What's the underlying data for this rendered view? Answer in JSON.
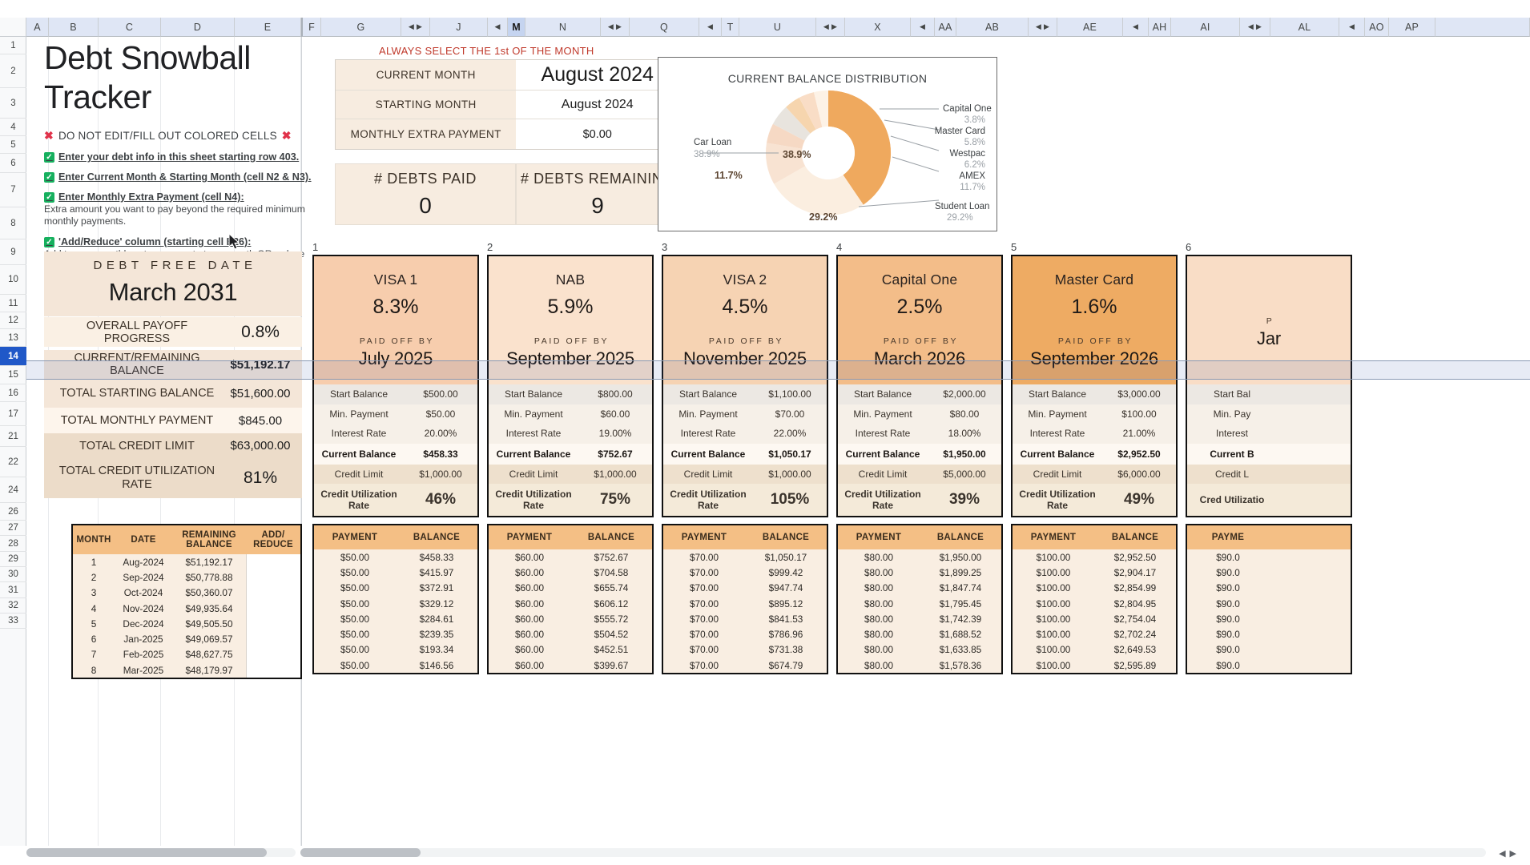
{
  "spreadsheet": {
    "column_headers": [
      "A",
      "B",
      "C",
      "D",
      "E",
      "F",
      "G",
      "J",
      "M",
      "N",
      "Q",
      "T",
      "U",
      "X",
      "AA",
      "AB",
      "AE",
      "AH",
      "AI",
      "AL",
      "AO",
      "AP"
    ],
    "row_headers": [
      "1",
      "2",
      "3",
      "4",
      "5",
      "6",
      "7",
      "8",
      "9",
      "10",
      "11",
      "12",
      "13",
      "14",
      "15",
      "16",
      "17",
      "21",
      "22",
      "24",
      "26",
      "27",
      "28",
      "29",
      "30",
      "31",
      "32",
      "33"
    ],
    "active_row": "14"
  },
  "left_panel": {
    "title_line1": "Debt Snowball",
    "title_line2": "Tracker",
    "warning": "DO NOT EDIT/FILL OUT COLORED CELLS",
    "tips": [
      {
        "head": "Enter your debt info in this sheet starting row 403.",
        "body": ""
      },
      {
        "head": "Enter Current Month & Starting Month (cell N2 & N3).",
        "body": ""
      },
      {
        "head": "Enter Monthly Extra Payment (cell N4):",
        "body": "Extra amount you want to pay beyond the required minimum monthly payments."
      },
      {
        "head": "'Add/Reduce' column (starting cell E26):",
        "body": "Add to your monthly extra payment at any month OR reduce your monthly extra payment (enter with MINUS)."
      }
    ],
    "debt_free_label": "DEBT FREE DATE",
    "debt_free_value": "March 2031",
    "summary_rows": [
      {
        "label": "OVERALL PAYOFF PROGRESS",
        "value": "0.8%",
        "big": true
      },
      {
        "label": "CURRENT/REMAINING BALANCE",
        "value": "$51,192.17",
        "big": false
      },
      {
        "label": "TOTAL STARTING BALANCE",
        "value": "$51,600.00",
        "big": false
      },
      {
        "label": "TOTAL MONTHLY PAYMENT",
        "value": "$845.00",
        "big": false
      },
      {
        "label": "TOTAL CREDIT LIMIT",
        "value": "$63,000.00",
        "big": false
      },
      {
        "label": "TOTAL CREDIT UTILIZATION RATE",
        "value": "81%",
        "big": true
      }
    ],
    "month_table": {
      "headers": [
        "MONTH",
        "DATE",
        "REMAINING BALANCE",
        "ADD/ REDUCE"
      ],
      "rows": [
        [
          "1",
          "Aug-2024",
          "$51,192.17",
          ""
        ],
        [
          "2",
          "Sep-2024",
          "$50,778.88",
          ""
        ],
        [
          "3",
          "Oct-2024",
          "$50,360.07",
          ""
        ],
        [
          "4",
          "Nov-2024",
          "$49,935.64",
          ""
        ],
        [
          "5",
          "Dec-2024",
          "$49,505.50",
          ""
        ],
        [
          "6",
          "Jan-2025",
          "$49,069.57",
          ""
        ],
        [
          "7",
          "Feb-2025",
          "$48,627.75",
          ""
        ],
        [
          "8",
          "Mar-2025",
          "$48,179.97",
          ""
        ]
      ]
    }
  },
  "banner": "ALWAYS SELECT THE 1st OF THE MONTH",
  "month_selector": [
    {
      "label": "CURRENT MONTH",
      "value": "August 2024",
      "size": "hero"
    },
    {
      "label": "STARTING MONTH",
      "value": "August 2024",
      "size": "mid"
    },
    {
      "label": "MONTHLY EXTRA PAYMENT",
      "value": "$0.00",
      "size": "sm"
    }
  ],
  "debt_counters": [
    {
      "label": "# DEBTS  PAID",
      "value": "0"
    },
    {
      "label": "# DEBTS REMAINING",
      "value": "9"
    }
  ],
  "chart_data": {
    "type": "pie",
    "title": "CURRENT BALANCE DISTRIBUTION",
    "labels": [
      "Car Loan",
      "Capital One",
      "Master Card",
      "Westpac",
      "AMEX",
      "Student Loan"
    ],
    "values": [
      38.9,
      3.8,
      5.8,
      6.2,
      11.7,
      29.2
    ],
    "value_labels": [
      "38.9%",
      "3.8%",
      "5.8%",
      "6.2%",
      "11.7%",
      "29.2%"
    ],
    "colors": [
      "#efa95e",
      "#f6d5ae",
      "#e8e4de",
      "#f6d9c4",
      "#f8e3d2",
      "#fbeee0"
    ],
    "inner_labels": [
      "38.9%",
      "11.7%",
      "29.2%"
    ],
    "legend": "callout-lines",
    "donut_hole": true
  },
  "debt_cards": [
    {
      "num": "1",
      "name": "VISA 1",
      "percent": "8.3%",
      "paid_off_label": "PAID OFF BY",
      "paid_off": "July 2025",
      "header_color": "#f7cdad",
      "rows": [
        {
          "k": "Start Balance",
          "v": "$500.00"
        },
        {
          "k": "Min. Payment",
          "v": "$50.00"
        },
        {
          "k": "Interest Rate",
          "v": "20.00%"
        },
        {
          "k": "Current Balance",
          "v": "$458.33"
        },
        {
          "k": "Credit Limit",
          "v": "$1,000.00"
        },
        {
          "k": "Credit Utilization Rate",
          "v": "46%"
        }
      ],
      "schedule_headers": [
        "PAYMENT",
        "BALANCE"
      ],
      "schedule": [
        [
          "$50.00",
          "$458.33"
        ],
        [
          "$50.00",
          "$415.97"
        ],
        [
          "$50.00",
          "$372.91"
        ],
        [
          "$50.00",
          "$329.12"
        ],
        [
          "$50.00",
          "$284.61"
        ],
        [
          "$50.00",
          "$239.35"
        ],
        [
          "$50.00",
          "$193.34"
        ],
        [
          "$50.00",
          "$146.56"
        ]
      ]
    },
    {
      "num": "2",
      "name": "NAB",
      "percent": "5.9%",
      "paid_off_label": "PAID OFF BY",
      "paid_off": "September 2025",
      "header_color": "#fae2cd",
      "rows": [
        {
          "k": "Start Balance",
          "v": "$800.00"
        },
        {
          "k": "Min. Payment",
          "v": "$60.00"
        },
        {
          "k": "Interest Rate",
          "v": "19.00%"
        },
        {
          "k": "Current Balance",
          "v": "$752.67"
        },
        {
          "k": "Credit Limit",
          "v": "$1,000.00"
        },
        {
          "k": "Credit Utilization Rate",
          "v": "75%"
        }
      ],
      "schedule_headers": [
        "PAYMENT",
        "BALANCE"
      ],
      "schedule": [
        [
          "$60.00",
          "$752.67"
        ],
        [
          "$60.00",
          "$704.58"
        ],
        [
          "$60.00",
          "$655.74"
        ],
        [
          "$60.00",
          "$606.12"
        ],
        [
          "$60.00",
          "$555.72"
        ],
        [
          "$60.00",
          "$504.52"
        ],
        [
          "$60.00",
          "$452.51"
        ],
        [
          "$60.00",
          "$399.67"
        ]
      ]
    },
    {
      "num": "3",
      "name": "VISA 2",
      "percent": "4.5%",
      "paid_off_label": "PAID OFF BY",
      "paid_off": "November 2025",
      "header_color": "#f6d3b3",
      "rows": [
        {
          "k": "Start Balance",
          "v": "$1,100.00"
        },
        {
          "k": "Min. Payment",
          "v": "$70.00"
        },
        {
          "k": "Interest Rate",
          "v": "22.00%"
        },
        {
          "k": "Current Balance",
          "v": "$1,050.17"
        },
        {
          "k": "Credit Limit",
          "v": "$1,000.00"
        },
        {
          "k": "Credit Utilization Rate",
          "v": "105%"
        }
      ],
      "schedule_headers": [
        "PAYMENT",
        "BALANCE"
      ],
      "schedule": [
        [
          "$70.00",
          "$1,050.17"
        ],
        [
          "$70.00",
          "$999.42"
        ],
        [
          "$70.00",
          "$947.74"
        ],
        [
          "$70.00",
          "$895.12"
        ],
        [
          "$70.00",
          "$841.53"
        ],
        [
          "$70.00",
          "$786.96"
        ],
        [
          "$70.00",
          "$731.38"
        ],
        [
          "$70.00",
          "$674.79"
        ]
      ]
    },
    {
      "num": "4",
      "name": "Capital One",
      "percent": "2.5%",
      "paid_off_label": "PAID OFF BY",
      "paid_off": "March 2026",
      "header_color": "#f3bd89",
      "rows": [
        {
          "k": "Start Balance",
          "v": "$2,000.00"
        },
        {
          "k": "Min. Payment",
          "v": "$80.00"
        },
        {
          "k": "Interest Rate",
          "v": "18.00%"
        },
        {
          "k": "Current Balance",
          "v": "$1,950.00"
        },
        {
          "k": "Credit Limit",
          "v": "$5,000.00"
        },
        {
          "k": "Credit Utilization Rate",
          "v": "39%"
        }
      ],
      "schedule_headers": [
        "PAYMENT",
        "BALANCE"
      ],
      "schedule": [
        [
          "$80.00",
          "$1,950.00"
        ],
        [
          "$80.00",
          "$1,899.25"
        ],
        [
          "$80.00",
          "$1,847.74"
        ],
        [
          "$80.00",
          "$1,795.45"
        ],
        [
          "$80.00",
          "$1,742.39"
        ],
        [
          "$80.00",
          "$1,688.52"
        ],
        [
          "$80.00",
          "$1,633.85"
        ],
        [
          "$80.00",
          "$1,578.36"
        ]
      ]
    },
    {
      "num": "5",
      "name": "Master Card",
      "percent": "1.6%",
      "paid_off_label": "PAID OFF BY",
      "paid_off": "September 2026",
      "header_color": "#eeab63",
      "rows": [
        {
          "k": "Start Balance",
          "v": "$3,000.00"
        },
        {
          "k": "Min. Payment",
          "v": "$100.00"
        },
        {
          "k": "Interest Rate",
          "v": "21.00%"
        },
        {
          "k": "Current Balance",
          "v": "$2,952.50"
        },
        {
          "k": "Credit Limit",
          "v": "$6,000.00"
        },
        {
          "k": "Credit Utilization Rate",
          "v": "49%"
        }
      ],
      "schedule_headers": [
        "PAYMENT",
        "BALANCE"
      ],
      "schedule": [
        [
          "$100.00",
          "$2,952.50"
        ],
        [
          "$100.00",
          "$2,904.17"
        ],
        [
          "$100.00",
          "$2,854.99"
        ],
        [
          "$100.00",
          "$2,804.95"
        ],
        [
          "$100.00",
          "$2,754.04"
        ],
        [
          "$100.00",
          "$2,702.24"
        ],
        [
          "$100.00",
          "$2,649.53"
        ],
        [
          "$100.00",
          "$2,595.89"
        ]
      ]
    },
    {
      "num": "6",
      "name": "",
      "percent": "",
      "paid_off_label": "P",
      "paid_off": "Jar",
      "header_color": "#f9ddc6",
      "rows": [
        {
          "k": "Start Bal",
          "v": ""
        },
        {
          "k": "Min. Pay",
          "v": ""
        },
        {
          "k": "Interest",
          "v": ""
        },
        {
          "k": "Current B",
          "v": ""
        },
        {
          "k": "Credit L",
          "v": ""
        },
        {
          "k": "Cred Utilizatio",
          "v": ""
        }
      ],
      "schedule_headers": [
        "PAYME",
        ""
      ],
      "schedule": [
        [
          "$90.0",
          ""
        ],
        [
          "$90.0",
          ""
        ],
        [
          "$90.0",
          ""
        ],
        [
          "$90.0",
          ""
        ],
        [
          "$90.0",
          ""
        ],
        [
          "$90.0",
          ""
        ],
        [
          "$90.0",
          ""
        ],
        [
          "$90.0",
          ""
        ]
      ]
    }
  ]
}
